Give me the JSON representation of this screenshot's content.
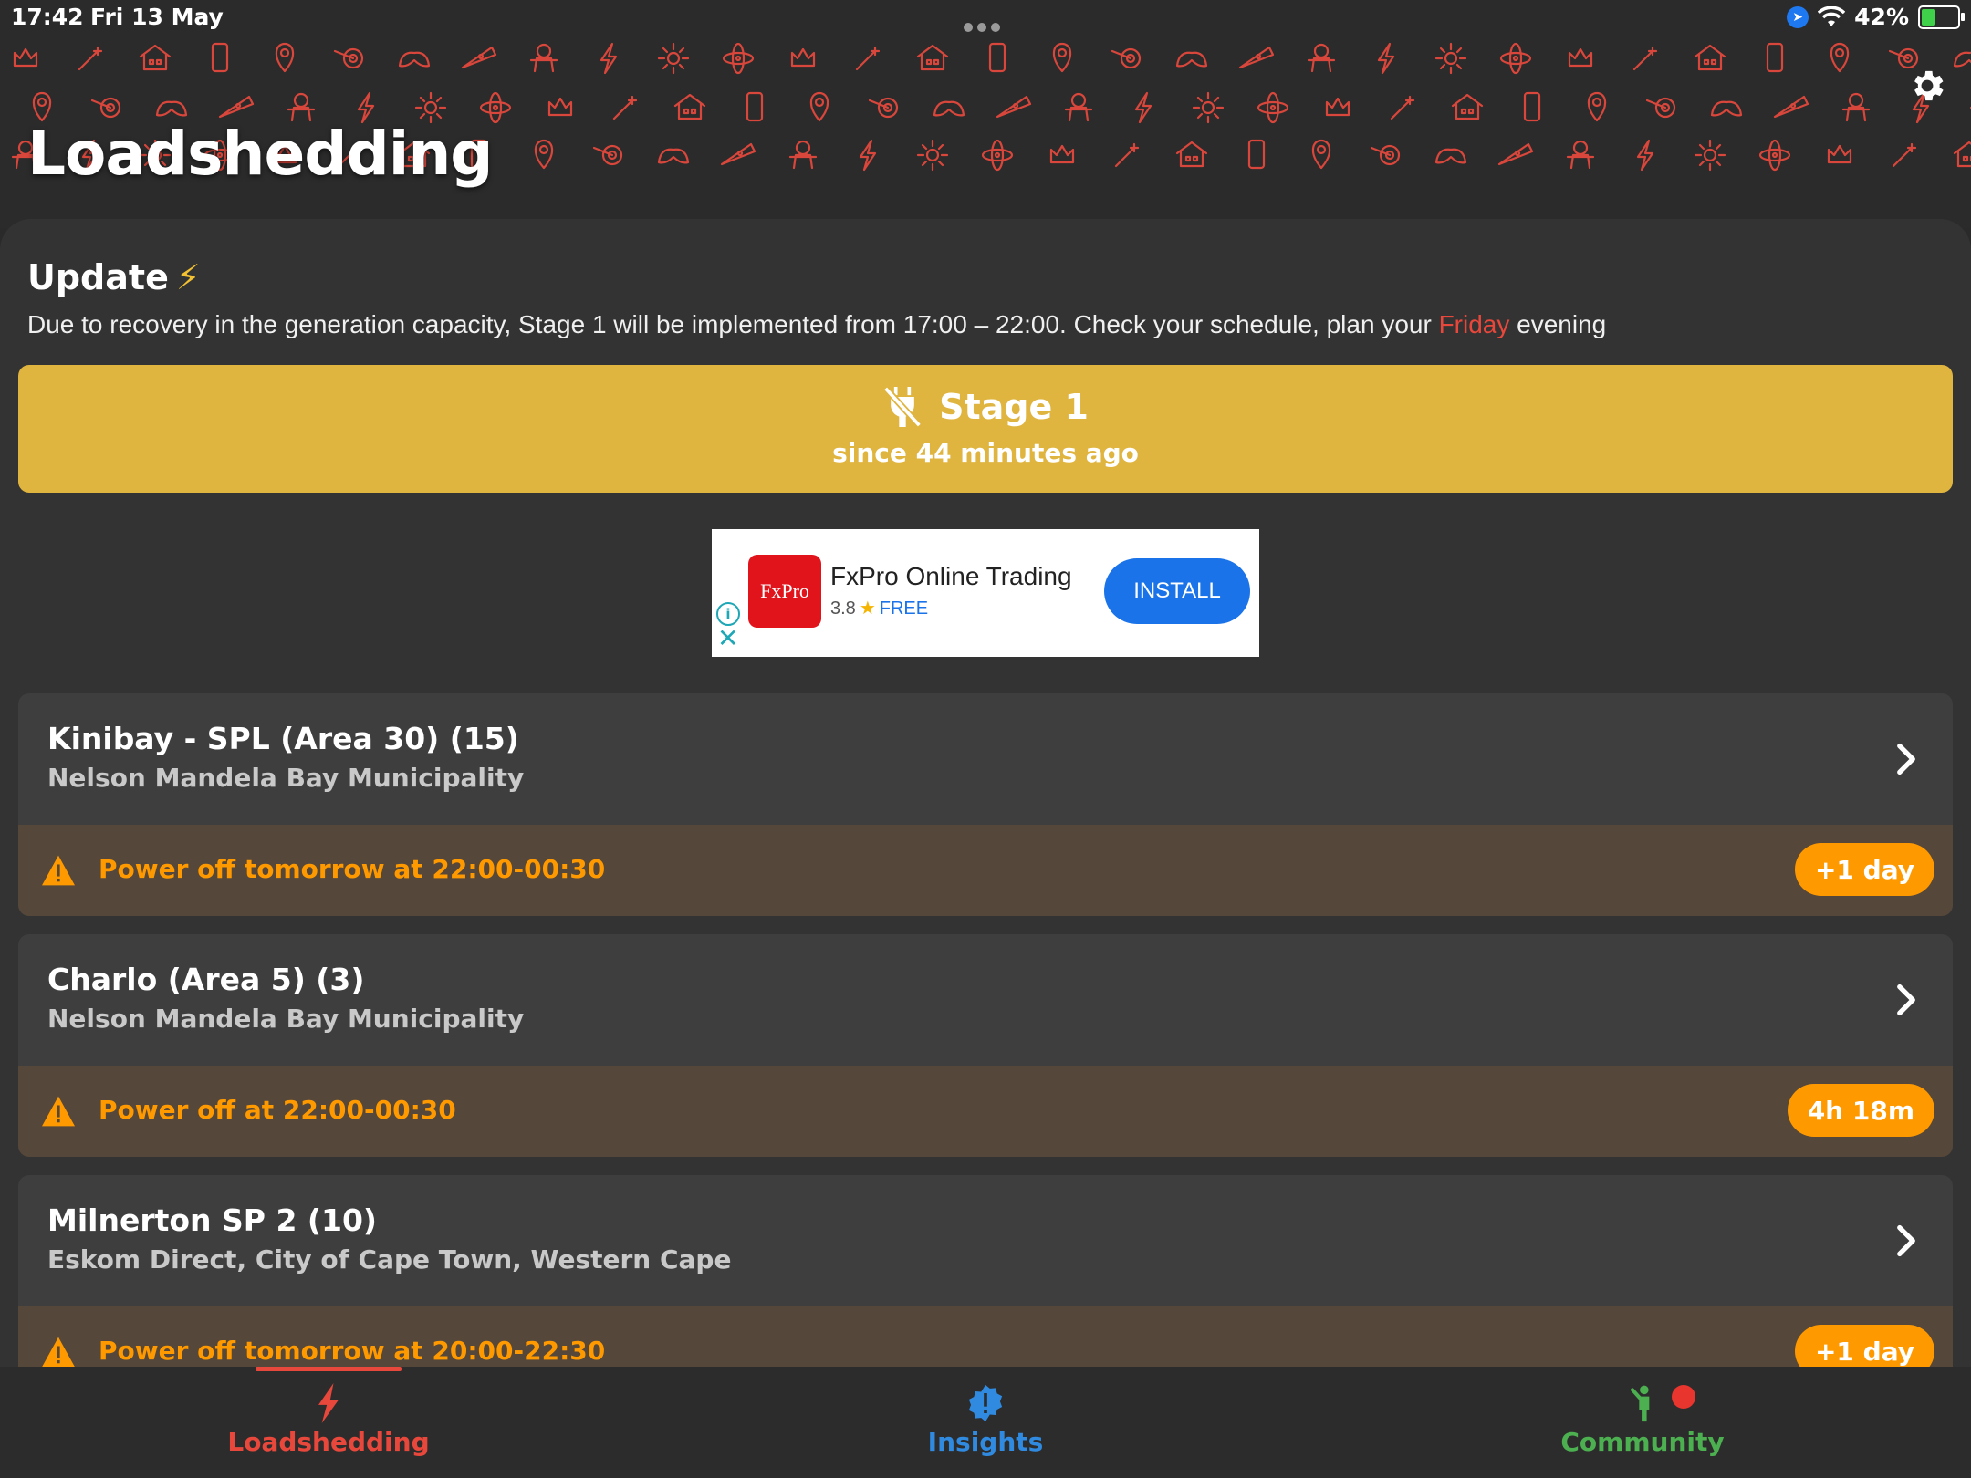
{
  "status_bar": {
    "time": "17:42",
    "date": "Fri 13 May",
    "battery": "42%",
    "battery_level": 0.42
  },
  "header": {
    "title": "Loadshedding",
    "pattern_color": "#d9463b"
  },
  "update": {
    "title": "Update",
    "text_before": "Due to recovery in the generation capacity, Stage 1 will be implemented from 17:00 – 22:00. Check your schedule, plan your ",
    "highlight": "Friday",
    "text_after": " evening"
  },
  "stage": {
    "label": "Stage 1",
    "since": "since 44 minutes ago",
    "color": "#dfb43f"
  },
  "ad": {
    "logo_text": "FxPro",
    "name": "FxPro Online Trading",
    "rating": "3.8",
    "price": "FREE",
    "install_label": "INSTALL"
  },
  "areas": [
    {
      "name": "Kinibay - SPL (Area 30) (15)",
      "municipality": "Nelson Mandela Bay Municipality",
      "status": "Power off tomorrow at 22:00-00:30",
      "badge": "+1 day"
    },
    {
      "name": "Charlo (Area 5) (3)",
      "municipality": "Nelson Mandela Bay Municipality",
      "status": "Power off at 22:00-00:30",
      "badge": "4h 18m"
    },
    {
      "name": "Milnerton SP 2 (10)",
      "municipality": "Eskom Direct, City of Cape Town, Western Cape",
      "status": "Power off tomorrow at 20:00-22:30",
      "badge": "+1 day"
    }
  ],
  "tabs": [
    {
      "label": "Loadshedding",
      "color": "#e8473b"
    },
    {
      "label": "Insights",
      "color": "#2f8ae0"
    },
    {
      "label": "Community",
      "color": "#4caf50"
    }
  ],
  "colors": {
    "warning": "#ff9900",
    "accent_red": "#e8473b"
  }
}
